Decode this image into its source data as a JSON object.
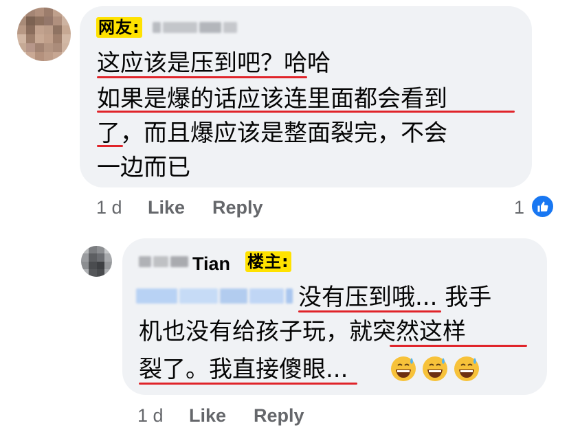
{
  "comment": {
    "tag": "网友:",
    "lines": [
      "这应该是压到吧？哈哈",
      "如果是爆的话应该连里面都会看到",
      "了，而且爆应该是整面裂完，不会",
      "一边而已"
    ],
    "time": "1 d",
    "like_label": "Like",
    "reply_label": "Reply",
    "reaction_count": "1"
  },
  "reply": {
    "author_visible": "Tian",
    "tag": "楼主:",
    "lines": [
      "没有压到哦... 我手",
      "机也没有给孩子玩，就突然这样",
      "裂了。我直接傻眼..."
    ],
    "emoji": [
      "grinning-sweat-emoji",
      "grinning-sweat-emoji",
      "grinning-sweat-emoji"
    ],
    "time": "1 d",
    "like_label": "Like",
    "reply_label": "Reply"
  },
  "colors": {
    "bubble": "#f0f2f5",
    "tag_bg": "#ffe200",
    "underline": "#e0242a",
    "meta_text": "#65676b",
    "like_blue": "#1877f2"
  }
}
